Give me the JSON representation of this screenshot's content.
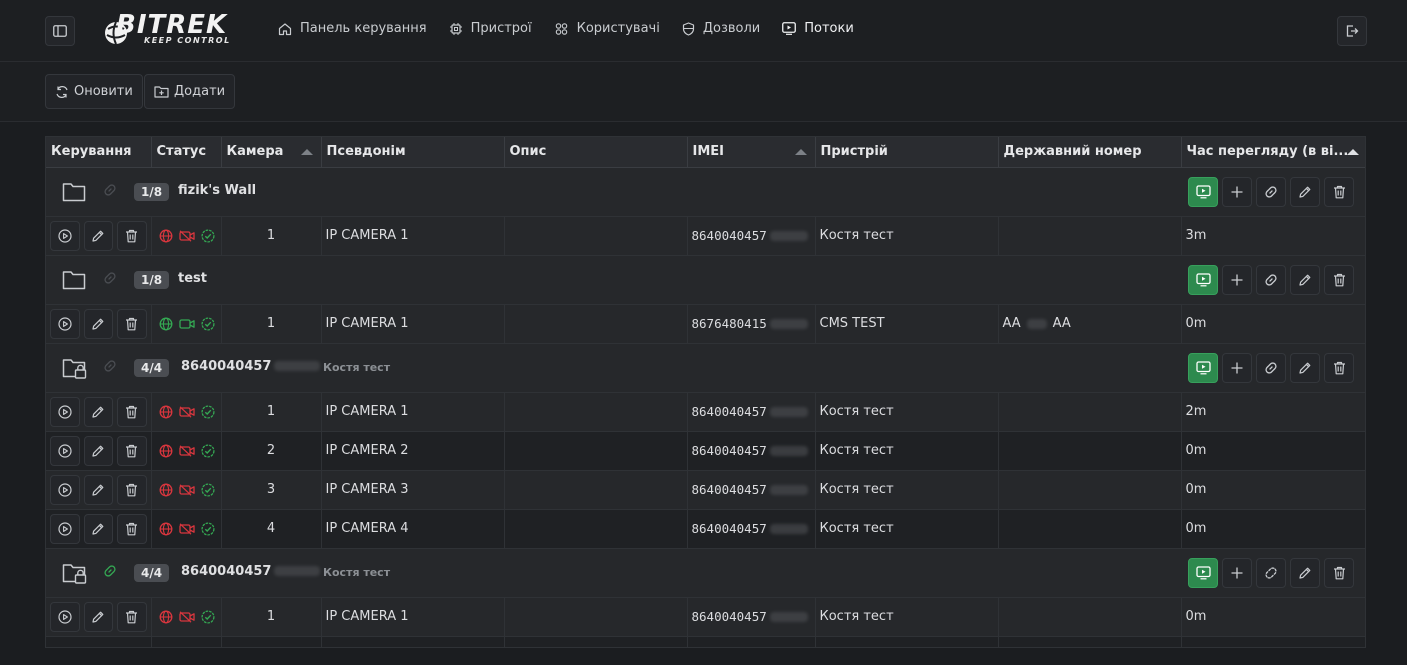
{
  "header": {
    "logo_text": "BITREK",
    "logo_sub": "KEEP CONTROL",
    "nav": [
      {
        "label": "Панель керування",
        "icon": "home-icon"
      },
      {
        "label": "Пристрої",
        "icon": "chip-icon"
      },
      {
        "label": "Користувачі",
        "icon": "users-icon"
      },
      {
        "label": "Дозволи",
        "icon": "shield-icon"
      },
      {
        "label": "Потоки",
        "icon": "stream-icon",
        "active": true
      }
    ]
  },
  "toolbar": {
    "refresh_label": "Оновити",
    "add_label": "Додати"
  },
  "table": {
    "columns": [
      "Керування",
      "Статус",
      "Камера",
      "Псевдонім",
      "Опис",
      "IMEI",
      "Пристрій",
      "Державний номер",
      "Час перегляду (в ві..."
    ],
    "groups": [
      {
        "badge": "1/8",
        "name": "fizik's Wall",
        "sub": "",
        "locked": false,
        "link_active": false,
        "rows": [
          {
            "camera": "1",
            "alias": "IP CAMERA 1",
            "imei": "8640040457",
            "device": "Костя тест",
            "plate_a": "",
            "plate_b": "",
            "time": "3m",
            "online": false
          }
        ]
      },
      {
        "badge": "1/8",
        "name": "test",
        "sub": "",
        "locked": false,
        "link_active": false,
        "rows": [
          {
            "camera": "1",
            "alias": "IP CAMERA 1",
            "imei": "8676480415",
            "device": "CMS TEST",
            "plate_a": "AA",
            "plate_b": "AA",
            "time": "0m",
            "online": true
          }
        ]
      },
      {
        "badge": "4/4",
        "name": "8640040457",
        "sub": "Костя тест",
        "locked": true,
        "link_active": false,
        "rows": [
          {
            "camera": "1",
            "alias": "IP CAMERA 1",
            "imei": "8640040457",
            "device": "Костя тест",
            "plate_a": "",
            "plate_b": "",
            "time": "2m",
            "online": false
          },
          {
            "camera": "2",
            "alias": "IP CAMERA 2",
            "imei": "8640040457",
            "device": "Костя тест",
            "plate_a": "",
            "plate_b": "",
            "time": "0m",
            "online": false
          },
          {
            "camera": "3",
            "alias": "IP CAMERA 3",
            "imei": "8640040457",
            "device": "Костя тест",
            "plate_a": "",
            "plate_b": "",
            "time": "0m",
            "online": false
          },
          {
            "camera": "4",
            "alias": "IP CAMERA 4",
            "imei": "8640040457",
            "device": "Костя тест",
            "plate_a": "",
            "plate_b": "",
            "time": "0m",
            "online": false
          }
        ]
      },
      {
        "badge": "4/4",
        "name": "8640040457",
        "sub": "Костя тест",
        "locked": true,
        "link_active": true,
        "rows": [
          {
            "camera": "1",
            "alias": "IP CAMERA 1",
            "imei": "8640040457",
            "device": "Костя тест",
            "plate_a": "",
            "plate_b": "",
            "time": "0m",
            "online": false
          },
          {
            "camera": "",
            "alias": "",
            "imei": "",
            "device": "",
            "plate_a": "",
            "plate_b": "",
            "time": "",
            "online": false
          }
        ]
      }
    ]
  },
  "colors": {
    "accent_green": "#2d8a4e",
    "status_red": "#d9363e",
    "status_green": "#34a853"
  }
}
